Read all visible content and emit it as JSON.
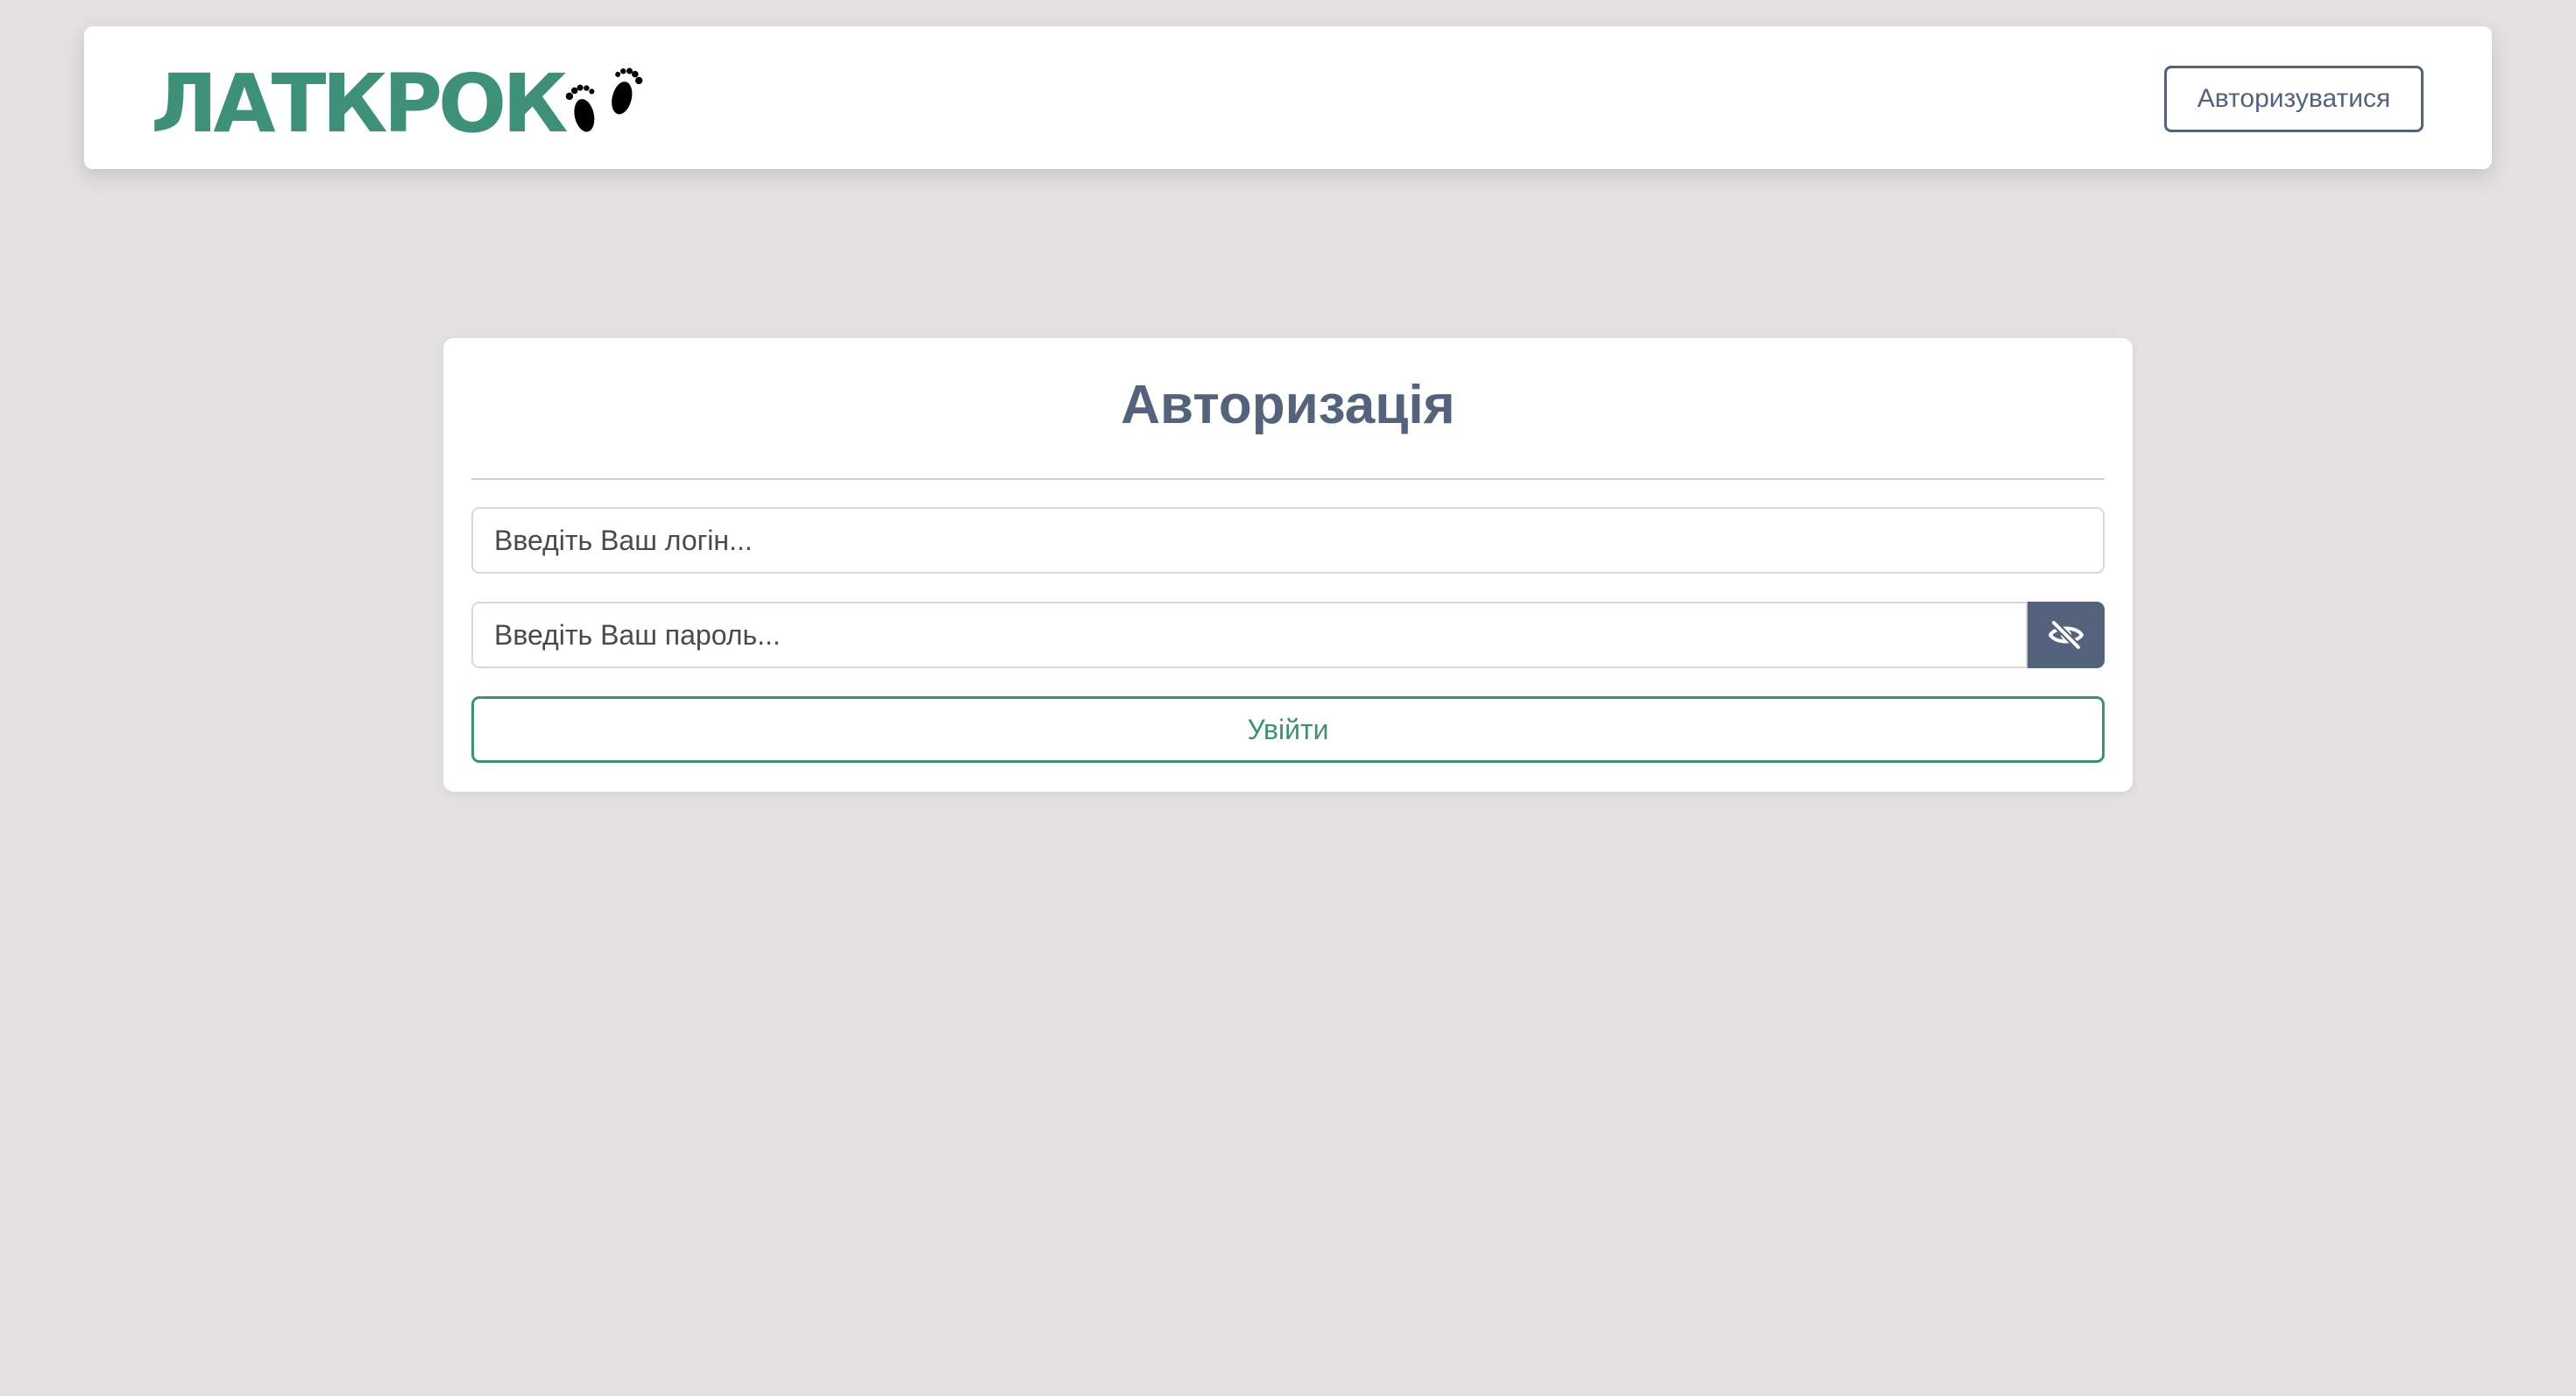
{
  "header": {
    "logo_text": "ЛАТКРОК",
    "logo_icon": "baby-feet-icon",
    "auth_button_label": "Авторизуватися"
  },
  "login_form": {
    "title": "Авторизація",
    "login_placeholder": "Введіть Ваш логін...",
    "password_placeholder": "Введіть Ваш пароль...",
    "toggle_visibility_icon": "eye-slash-icon",
    "submit_label": "Увійти"
  },
  "colors": {
    "background": "#e2e0e1",
    "brand_green": "#3f9078",
    "slate": "#55627c",
    "surface": "#ffffff"
  }
}
